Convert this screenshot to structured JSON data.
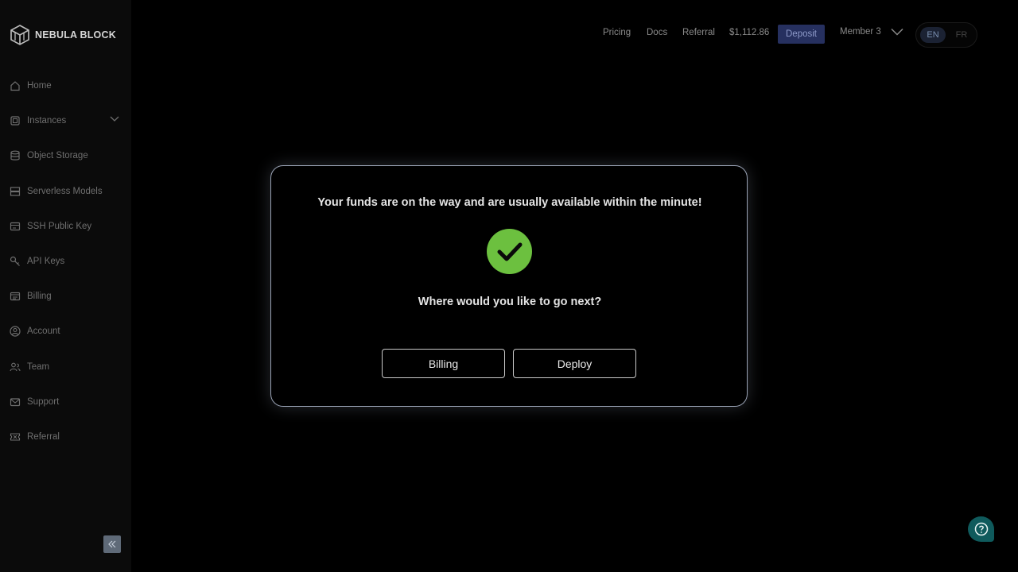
{
  "brand": {
    "name": "NEBULA BLOCK"
  },
  "sidebar": {
    "items": [
      {
        "label": "Home",
        "icon": "home-icon"
      },
      {
        "label": "Instances",
        "icon": "chip-icon"
      },
      {
        "label": "Object Storage",
        "icon": "database-icon"
      },
      {
        "label": "Serverless Models",
        "icon": "server-icon"
      },
      {
        "label": "SSH Public Key",
        "icon": "key-card-icon"
      },
      {
        "label": "API Keys",
        "icon": "key-icon"
      },
      {
        "label": "Billing",
        "icon": "billing-icon"
      },
      {
        "label": "Account",
        "icon": "account-icon"
      },
      {
        "label": "Team",
        "icon": "team-icon"
      },
      {
        "label": "Support",
        "icon": "mail-icon"
      },
      {
        "label": "Referral",
        "icon": "ticket-icon"
      }
    ]
  },
  "header": {
    "links": [
      "Pricing",
      "Docs",
      "Referral"
    ],
    "balance": "$1,112.86",
    "deposit_label": "Deposit",
    "member_label": "Member 3",
    "lang_en": "EN",
    "lang_fr": "FR"
  },
  "modal": {
    "message": "Your funds are on the way and are usually available within the minute!",
    "question": "Where would you like to go next?",
    "billing_label": "Billing",
    "deploy_label": "Deploy"
  },
  "colors": {
    "success": "#6cc03f",
    "deposit_bg": "#26305f",
    "help_bg": "#0f5a5c"
  }
}
